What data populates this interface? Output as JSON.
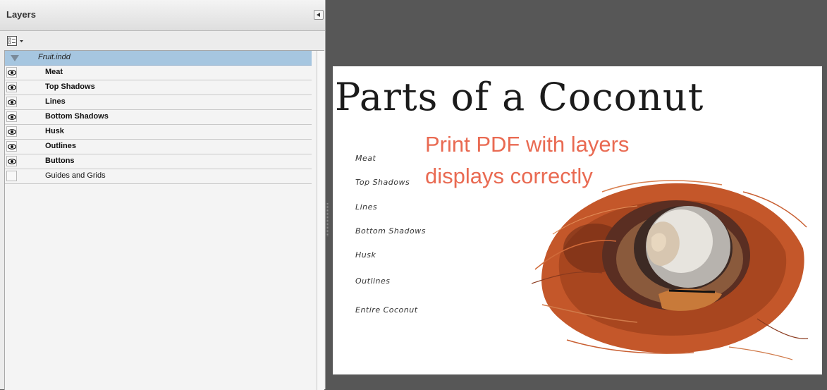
{
  "panel": {
    "title": "Layers",
    "document_name": "Fruit.indd",
    "layers": [
      {
        "name": "Meat",
        "visible": true
      },
      {
        "name": "Top Shadows",
        "visible": true
      },
      {
        "name": "Lines",
        "visible": true
      },
      {
        "name": "Bottom Shadows",
        "visible": true
      },
      {
        "name": "Husk",
        "visible": true
      },
      {
        "name": "Outlines",
        "visible": true
      },
      {
        "name": "Buttons",
        "visible": true
      },
      {
        "name": "Guides and Grids",
        "visible": false
      }
    ]
  },
  "document": {
    "title": "Parts of a Coconut",
    "parts": [
      "Meat",
      "Top Shadows",
      "Lines",
      "Bottom Shadows",
      "Husk",
      "Outlines",
      "Entire Coconut"
    ],
    "annotation_line1": "Print PDF with layers",
    "annotation_line2": "displays correctly"
  },
  "colors": {
    "annotation": "#e96a52",
    "selected_row": "#a6c6e0",
    "workspace": "#575757"
  },
  "icons": [
    "collapse-arrow-icon",
    "panel-options-icon",
    "eye-icon",
    "disclosure-triangle-icon"
  ]
}
